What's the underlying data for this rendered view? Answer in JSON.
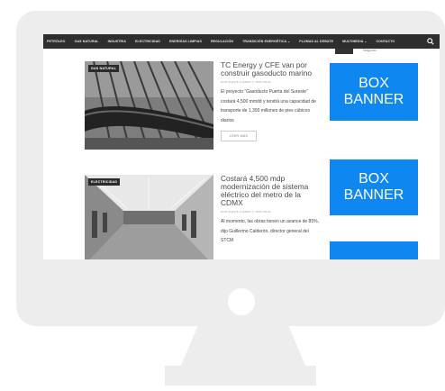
{
  "nav": {
    "items": [
      "PETRÓLEO",
      "GAS NATURAL",
      "INDUSTRIA",
      "ELECTRICIDAD",
      "ENERGÍAS LIMPIAS",
      "REGULACIÓN",
      "TRANSICIÓN ENERGÉTICA ⌄",
      "PLUMAS AL DEBATE",
      "MULTIMEDIA ⌄",
      "CONTACTO"
    ],
    "search_icon": "search-icon"
  },
  "sidebar": {
    "top_link": "Negocio",
    "banners": [
      {
        "line1": "BOX",
        "line2": "BANNER"
      },
      {
        "line1": "BOX",
        "line2": "BANNER"
      },
      {
        "line1": "",
        "line2": ""
      }
    ],
    "banner_color": "#0f87f0"
  },
  "articles": [
    {
      "category": "GAS NATURAL",
      "title": "TC Energy y CFE van por construir gasoducto marino",
      "meta": "POR ALEXIS JUÁREZ  ◷ 2022-08-03",
      "excerpt": "El proyecto “Gasoducto Puerta del Sureste” costará 4,500 mmdd y tendrá una capacidad de transporte de 1,300 millones de pies cúbicos diarios",
      "read_more": "LEER MÁS"
    },
    {
      "category": "ELECTRICIDAD",
      "title": "Costará 4,500 mdp modernización de sistema eléctrico del metro de la CDMX",
      "meta": "POR ALEXIS JUÁREZ  ◷ 2022-08-03",
      "excerpt": "Al momento, las obras tienen un avance de 85%, dijo Guillermo Calderón, director general del STCM",
      "read_more": ""
    }
  ]
}
